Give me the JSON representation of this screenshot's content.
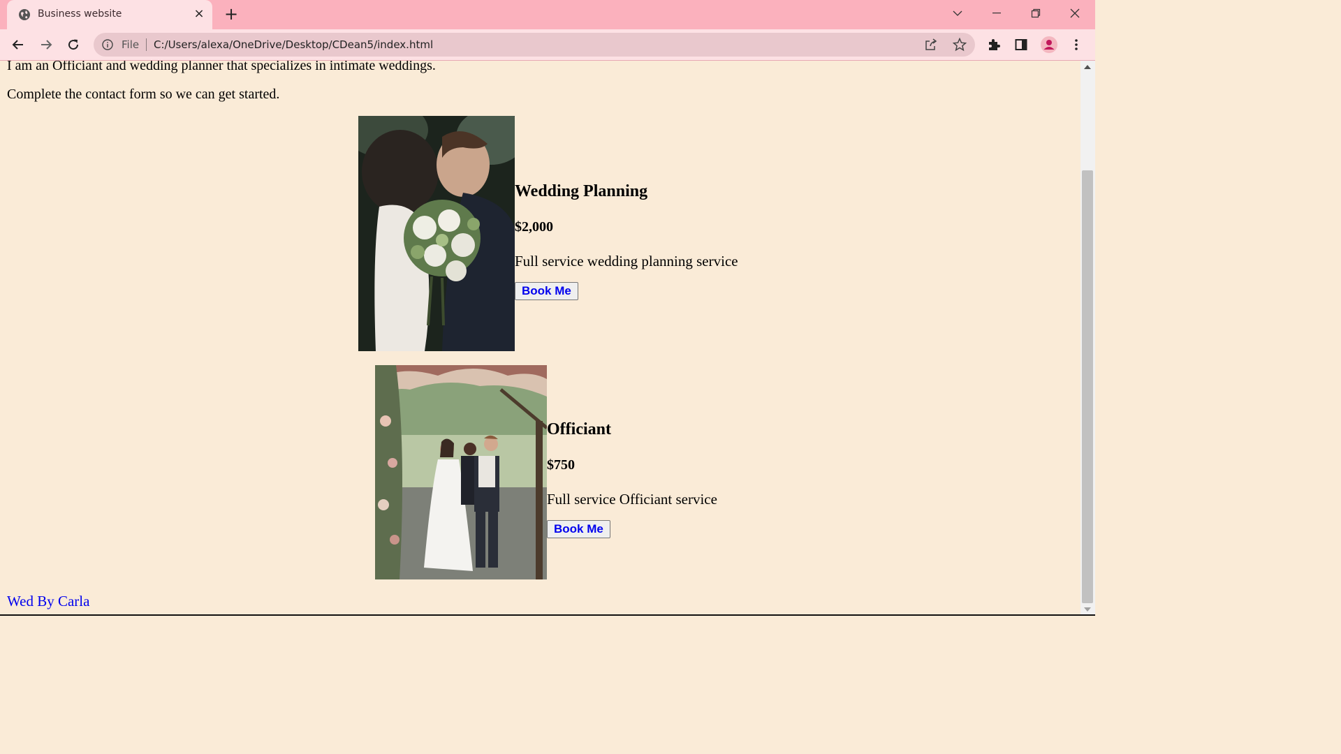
{
  "browser": {
    "tab_title": "Business website",
    "tab_close": "×",
    "new_tab": "+",
    "scheme_label": "File",
    "url": "C:/Users/alexa/OneDrive/Desktop/CDean5/index.html"
  },
  "page": {
    "intro_line": "I am an Officiant and wedding planner that specializes in intimate weddings.",
    "contact_line": "Complete the contact form so we can get started.",
    "services": [
      {
        "title": "Wedding Planning",
        "price": "$2,000",
        "description": "Full service wedding planning service",
        "button": "Book Me"
      },
      {
        "title": "Officiant",
        "price": "$750",
        "description": "Full service Officiant service",
        "button": "Book Me"
      }
    ],
    "footer_link": "Wed By Carla"
  },
  "colors": {
    "page_background": "#faebd7",
    "tabstrip": "#fbb1bd",
    "toolbar": "#fde1e4",
    "link": "#0000ee"
  },
  "icons": [
    "globe-icon",
    "close-icon",
    "plus-icon",
    "chevron-down-icon",
    "minimize-icon",
    "restore-icon",
    "window-close-icon",
    "back-icon",
    "forward-icon",
    "reload-icon",
    "info-icon",
    "share-icon",
    "star-icon",
    "extensions-icon",
    "side-panel-icon",
    "profile-icon",
    "menu-icon"
  ]
}
